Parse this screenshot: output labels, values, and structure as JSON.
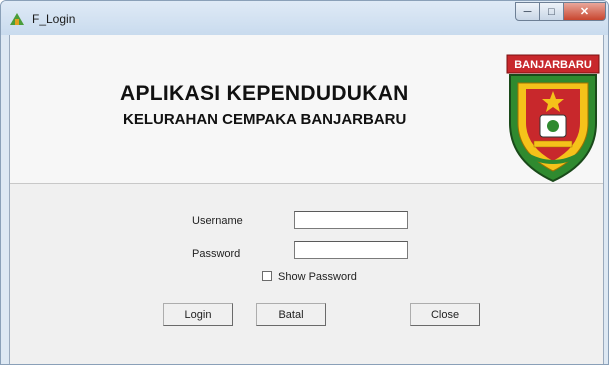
{
  "window": {
    "title": "F_Login",
    "controls": {
      "minimize": "─",
      "maximize": "□",
      "close": "✕"
    }
  },
  "header": {
    "title": "APLIKASI KEPENDUDUKAN",
    "subtitle": "KELURAHAN CEMPAKA BANJARBARU",
    "logo_text": "BANJARBARU"
  },
  "form": {
    "username_label": "Username",
    "username_value": "",
    "password_label": "Password",
    "password_value": "",
    "show_password_label": "Show Password",
    "show_password_checked": false
  },
  "buttons": {
    "login": "Login",
    "batal": "Batal",
    "close": "Close"
  },
  "colors": {
    "logo_green": "#2f8a2f",
    "logo_red": "#c8282c",
    "logo_yellow": "#f5c21a"
  }
}
